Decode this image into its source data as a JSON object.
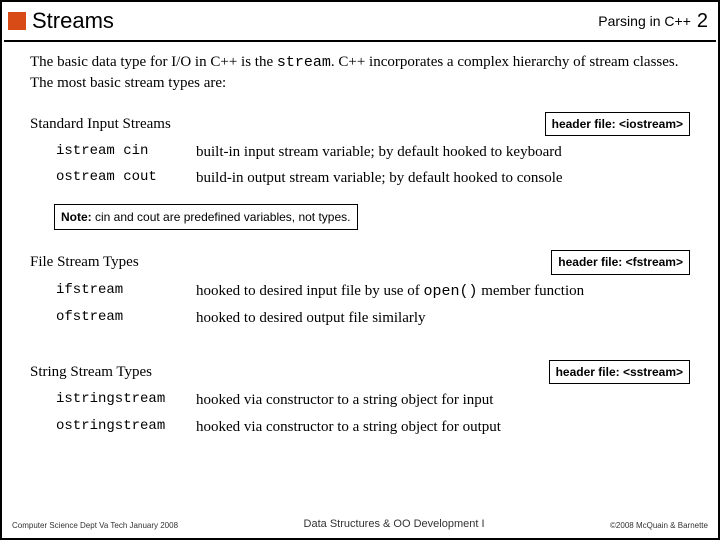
{
  "header": {
    "title": "Streams",
    "right": "Parsing in C++",
    "page": "2"
  },
  "intro": {
    "pre": "The basic data type for I/O in C++ is the ",
    "code": "stream",
    "post": ".  C++ incorporates a complex hierarchy of stream classes.  The most basic stream types are:"
  },
  "sections": [
    {
      "heading": "Standard Input Streams",
      "header_file": "header file: <iostream>",
      "items": [
        {
          "name": "istream cin",
          "desc": "built-in input stream variable; by default hooked to keyboard"
        },
        {
          "name": "ostream cout",
          "desc": "build-in output stream variable; by default hooked to console"
        }
      ],
      "note_label": "Note:  ",
      "note_text": "cin and cout are predefined variables, not types."
    },
    {
      "heading": "File Stream Types",
      "header_file": "header file: <fstream>",
      "items": [
        {
          "name": "ifstream",
          "desc_pre": "hooked to desired input file by use of ",
          "desc_code": "open()",
          "desc_post": " member function"
        },
        {
          "name": "ofstream",
          "desc": "hooked to desired output file similarly"
        }
      ]
    },
    {
      "heading": "String Stream Types",
      "header_file": "header file: <sstream>",
      "items": [
        {
          "name": "istringstream",
          "desc": "hooked via constructor to a string object for input"
        },
        {
          "name": "ostringstream",
          "desc": "hooked via constructor to a string object for output"
        }
      ]
    }
  ],
  "footer": {
    "left": "Computer Science Dept Va Tech January 2008",
    "center": "Data Structures & OO Development I",
    "right": "©2008 McQuain & Barnette"
  }
}
